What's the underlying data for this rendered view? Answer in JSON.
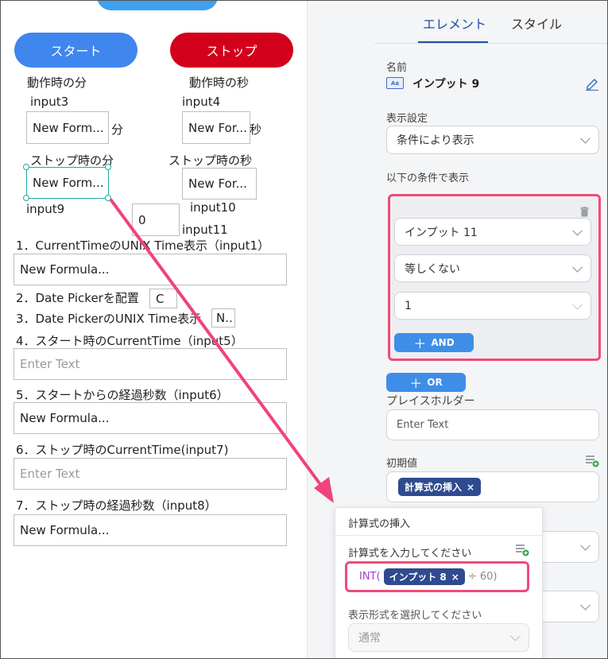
{
  "canvas": {
    "start_button": "スタート",
    "stop_button": "ストップ",
    "minute_label": "動作時の分",
    "second_label": "動作時の秒",
    "input3": "input3",
    "input4": "input4",
    "box3": "New Form...",
    "box4": "New For...",
    "unit_min": "分",
    "unit_sec": "秒",
    "stop_minute_label": "ストップ時の分",
    "stop_second_label": "ストップ時の秒",
    "box9": "New Form...",
    "box10": "New For...",
    "input9": "input9",
    "input10": "input10",
    "input11": "input11",
    "box11": "0",
    "line1": "1．CurrentTimeのUNIX Time表示（input1）",
    "box1": "New Formula...",
    "line2": "2．Date Pickerを配置",
    "box2": "C",
    "line3": "3．Date PickerのUNIX Time表示",
    "box_line3": "N..",
    "line4": "4．スタート時のCurrentTime（input5）",
    "box5": "Enter Text",
    "line5": "5．スタートからの経過秒数（input6）",
    "box6": "New Formula...",
    "line6": "6．ストップ時のCurrentTime(input7)",
    "box7": "Enter Text",
    "line7": "7．ストップ時の経過秒数（input8）",
    "box8": "New Formula..."
  },
  "panel": {
    "tab_element": "エレメント",
    "tab_style": "スタイル",
    "name_label": "名前",
    "element_name": "インプット 9",
    "display_label": "表示設定",
    "display_value": "条件により表示",
    "condition_label": "以下の条件で表示",
    "cond_field": "インプット 11",
    "cond_operator": "等しくない",
    "cond_value": "1",
    "and_button": "AND",
    "or_button": "OR",
    "placeholder_label": "プレイスホルダー",
    "placeholder_value": "Enter Text",
    "initial_label": "初期値",
    "initial_chip": "計算式の挿入",
    "chip_close": "×"
  },
  "popup": {
    "title": "計算式の挿入",
    "formula_label": "計算式を入力してください",
    "formula_prefix": "INT(",
    "formula_chip": "インプット 8",
    "formula_suffix": "÷ 60)",
    "format_label": "表示形式を選択してください",
    "format_value": "通常"
  },
  "colors": {
    "start": "#3f86ee",
    "stop": "#d3001b",
    "accent": "#1e4fa3",
    "highlight": "#ef4b7a"
  }
}
